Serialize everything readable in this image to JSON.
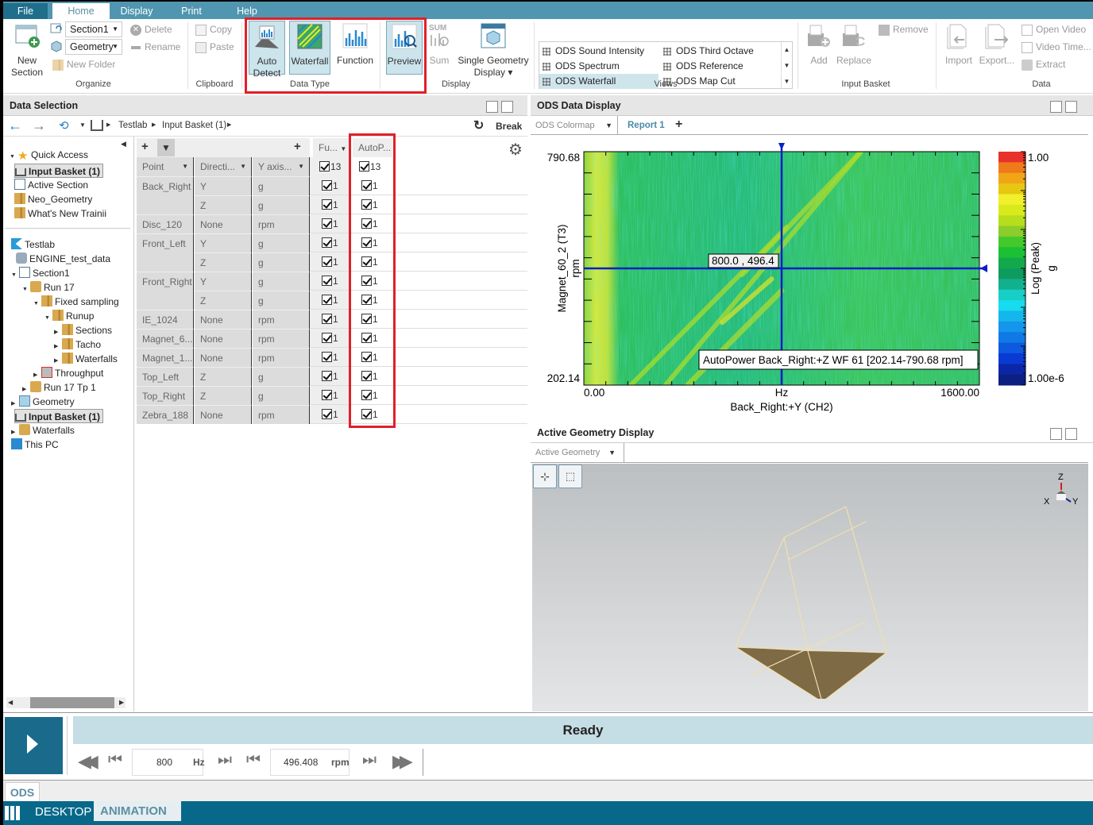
{
  "menu_tabs": [
    "File",
    "Home",
    "Display",
    "Print",
    "Help"
  ],
  "ribbon": {
    "organize": {
      "label": "Organize",
      "new_section": "New\nSection",
      "new_section_l1": "New",
      "new_section_l2": "Section",
      "section_combo": "Section1",
      "geometry_combo": "Geometry",
      "delete": "Delete",
      "rename": "Rename",
      "new_folder": "New Folder"
    },
    "clipboard": {
      "label": "Clipboard",
      "copy": "Copy",
      "paste": "Paste"
    },
    "data_type": {
      "label": "Data Type",
      "auto_detect_l1": "Auto",
      "auto_detect_l2": "Detect",
      "waterfall": "Waterfall",
      "function": "Function",
      "preview": "Preview"
    },
    "display": {
      "label": "Display",
      "sum": "Sum",
      "single_geometry_l1": "Single Geometry",
      "single_geometry_l2": "Display ▾"
    },
    "views": {
      "label": "Views",
      "items": [
        "ODS Sound Intensity",
        "ODS Third Octave",
        "ODS Spectrum",
        "ODS Reference",
        "ODS Waterfall",
        "ODS Map Cut"
      ],
      "selected": "ODS Waterfall"
    },
    "input_basket": {
      "label": "Input Basket",
      "add": "Add",
      "replace": "Replace",
      "remove": "Remove"
    },
    "data": {
      "label": "Data",
      "import": "Import",
      "export": "Export...",
      "open_video": "Open Video",
      "video_time": "Video Time...",
      "extract": "Extract"
    }
  },
  "data_selection": {
    "title": "Data Selection",
    "breadcrumb": [
      "Testlab",
      "Input Basket (1)"
    ],
    "break_label": "Break",
    "tree": [
      {
        "label": "Quick Access",
        "level": 0,
        "expanded": true,
        "icon": "star-icon"
      },
      {
        "label": "Input Basket (1)",
        "level": 1,
        "icon": "basket-icon",
        "selected": true
      },
      {
        "label": "Active Section",
        "level": 1,
        "icon": "section-icon"
      },
      {
        "label": "Neo_Geometry",
        "level": 1,
        "icon": "folder-icon"
      },
      {
        "label": "What's New Trainii",
        "level": 1,
        "icon": "folder-icon"
      },
      {
        "label": "Testlab",
        "level": 0,
        "icon": "testlab-icon"
      },
      {
        "label": "ENGINE_test_data",
        "level": 0,
        "icon": "database-icon"
      },
      {
        "label": "Section1",
        "level": 1,
        "expanded": true,
        "icon": "section-icon"
      },
      {
        "label": "Run 17",
        "level": 2,
        "expanded": true,
        "icon": "run-icon"
      },
      {
        "label": "Fixed sampling",
        "level": 3,
        "expanded": true,
        "icon": "folder-icon"
      },
      {
        "label": "Runup",
        "level": 4,
        "expanded": true,
        "icon": "folder-icon"
      },
      {
        "label": "Sections",
        "level": 5,
        "icon": "folder-icon"
      },
      {
        "label": "Tacho",
        "level": 5,
        "icon": "folder-icon"
      },
      {
        "label": "Waterfalls",
        "level": 5,
        "icon": "folder-icon"
      },
      {
        "label": "Throughput",
        "level": 3,
        "icon": "throughput-icon"
      },
      {
        "label": "Run 17 Tp 1",
        "level": 2,
        "icon": "run-icon"
      },
      {
        "label": "Geometry",
        "level": 1,
        "icon": "geometry-icon"
      },
      {
        "label": "Input Basket (1)",
        "level": 1,
        "icon": "basket-icon",
        "selected": true
      },
      {
        "label": "Waterfalls",
        "level": 1,
        "icon": "run-icon"
      },
      {
        "label": "This PC",
        "level": 0,
        "icon": "pc-icon"
      }
    ],
    "table": {
      "group_headers": [
        "Fu...",
        "AutoP..."
      ],
      "columns": [
        "Point",
        "Directi...",
        "Y axis..."
      ],
      "check_totals": [
        "13",
        "13"
      ],
      "rows": [
        {
          "point": "Back_Right",
          "dir": "Y",
          "unit": "g",
          "c1": "1",
          "c2": "1"
        },
        {
          "point": "",
          "dir": "Z",
          "unit": "g",
          "c1": "1",
          "c2": "1"
        },
        {
          "point": "Disc_120",
          "dir": "None",
          "unit": "rpm",
          "c1": "1",
          "c2": "1"
        },
        {
          "point": "Front_Left",
          "dir": "Y",
          "unit": "g",
          "c1": "1",
          "c2": "1"
        },
        {
          "point": "",
          "dir": "Z",
          "unit": "g",
          "c1": "1",
          "c2": "1"
        },
        {
          "point": "Front_Right",
          "dir": "Y",
          "unit": "g",
          "c1": "1",
          "c2": "1"
        },
        {
          "point": "",
          "dir": "Z",
          "unit": "g",
          "c1": "1",
          "c2": "1"
        },
        {
          "point": "IE_1024",
          "dir": "None",
          "unit": "rpm",
          "c1": "1",
          "c2": "1"
        },
        {
          "point": "Magnet_6...",
          "dir": "None",
          "unit": "rpm",
          "c1": "1",
          "c2": "1"
        },
        {
          "point": "Magnet_1...",
          "dir": "None",
          "unit": "rpm",
          "c1": "1",
          "c2": "1"
        },
        {
          "point": "Top_Left",
          "dir": "Z",
          "unit": "g",
          "c1": "1",
          "c2": "1"
        },
        {
          "point": "Top_Right",
          "dir": "Z",
          "unit": "g",
          "c1": "1",
          "c2": "1"
        },
        {
          "point": "Zebra_188",
          "dir": "None",
          "unit": "rpm",
          "c1": "1",
          "c2": "1"
        }
      ]
    }
  },
  "ods_display": {
    "title": "ODS Data Display",
    "view_combo": "ODS Colormap",
    "report_tab": "Report 1",
    "add_tab": "+"
  },
  "chart_data": {
    "type": "heatmap",
    "title": "",
    "xlabel": "Back_Right:+Y (CH2)",
    "x_unit": "Hz",
    "ylabel": "Magnet_60_2 (T3)",
    "y_unit": "rpm",
    "xlim": [
      0,
      1600
    ],
    "ylim": [
      202.14,
      790.68
    ],
    "x_tick_labels": [
      "0.00",
      "Hz",
      "1600.00"
    ],
    "y_tick_labels": [
      "790.68",
      "202.14"
    ],
    "cursor": {
      "x": 800.0,
      "y": 496.4,
      "label": "800.0 , 496.4"
    },
    "legend_text": "AutoPower Back_Right:+Z WF 61 [202.14-790.68 rpm]",
    "colorbar": {
      "label": "Log (Peak)",
      "unit": "g",
      "max": "1.00",
      "min": "1.00e-6",
      "scale": "log",
      "colors": [
        "#e8312a",
        "#ef7a1a",
        "#f0a517",
        "#e7c712",
        "#f2ef2c",
        "#d9ea1c",
        "#b7de1c",
        "#8ccc2b",
        "#43c92c",
        "#1cc035",
        "#13a94b",
        "#0e9b5e",
        "#11b08f",
        "#18cfc8",
        "#17dbef",
        "#14b6ec",
        "#1496ea",
        "#0f7ae6",
        "#0d5ae0",
        "#0a3ad4",
        "#0b27a8",
        "#0d1f80"
      ]
    },
    "orders": [
      {
        "note": "diagonal order lines rising from low Hz/low rpm to higher Hz/higher rpm"
      }
    ]
  },
  "geometry_display": {
    "title": "Active Geometry Display",
    "combo": "Active Geometry",
    "axes": {
      "z": "Z",
      "x": "X",
      "y": "Y"
    }
  },
  "animation": {
    "status": "Ready",
    "freq_value": "800",
    "freq_unit": "Hz",
    "rpm_value": "496.408",
    "rpm_unit": "rpm"
  },
  "bottom_tabs": {
    "ods": "ODS"
  },
  "taskbar": {
    "desktop": "DESKTOP",
    "animation": "ANIMATION"
  },
  "colors": {
    "accent": "#1a6a8c",
    "highlight_box": "#e0202a",
    "status_bg": "#c5dde4",
    "cursor": "#0a1fc8"
  }
}
